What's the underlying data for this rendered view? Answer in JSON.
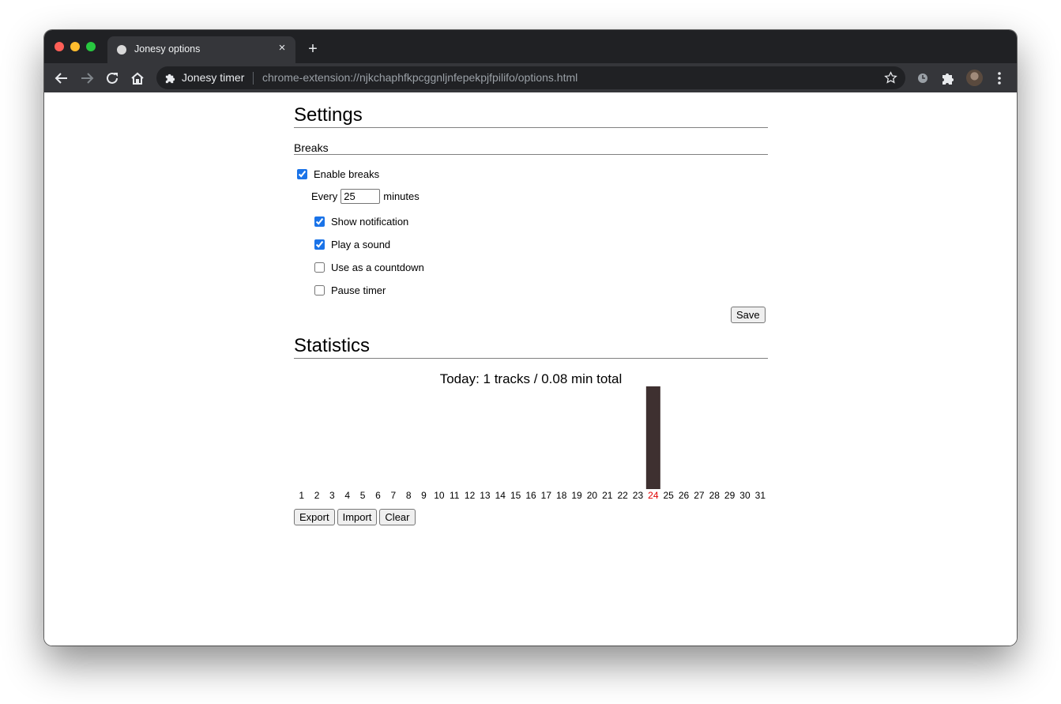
{
  "browser": {
    "tab_title": "Jonesy options",
    "new_tab_symbol": "+",
    "close_symbol": "×",
    "omnibox_name": "Jonesy timer",
    "url": "chrome-extension://njkchaphfkpcggnljnfepekpjfpilifo/options.html"
  },
  "settings": {
    "title": "Settings",
    "breaks_heading": "Breaks",
    "enable_breaks": {
      "label": "Enable breaks",
      "checked": true
    },
    "every_prefix": "Every",
    "interval_value": "25",
    "every_suffix": "minutes",
    "show_notification": {
      "label": "Show notification",
      "checked": true
    },
    "play_sound": {
      "label": "Play a sound",
      "checked": true
    },
    "countdown": {
      "label": "Use as a countdown",
      "checked": false
    },
    "pause_timer": {
      "label": "Pause timer",
      "checked": false
    },
    "save_label": "Save"
  },
  "statistics": {
    "title": "Statistics",
    "today_summary": "Today: 1 tracks / 0.08 min total",
    "export_label": "Export",
    "import_label": "Import",
    "clear_label": "Clear"
  },
  "chart_data": {
    "type": "bar",
    "categories": [
      "1",
      "2",
      "3",
      "4",
      "5",
      "6",
      "7",
      "8",
      "9",
      "10",
      "11",
      "12",
      "13",
      "14",
      "15",
      "16",
      "17",
      "18",
      "19",
      "20",
      "21",
      "22",
      "23",
      "24",
      "25",
      "26",
      "27",
      "28",
      "29",
      "30",
      "31"
    ],
    "values": [
      0,
      0,
      0,
      0,
      0,
      0,
      0,
      0,
      0,
      0,
      0,
      0,
      0,
      0,
      0,
      0,
      0,
      0,
      0,
      0,
      0,
      0,
      0,
      0.08,
      0,
      0,
      0,
      0,
      0,
      0,
      0
    ],
    "highlight_category": "24",
    "bar_color": "#3e3030",
    "highlight_label_color": "#e00000",
    "title": "",
    "xlabel": "",
    "ylabel": ""
  }
}
